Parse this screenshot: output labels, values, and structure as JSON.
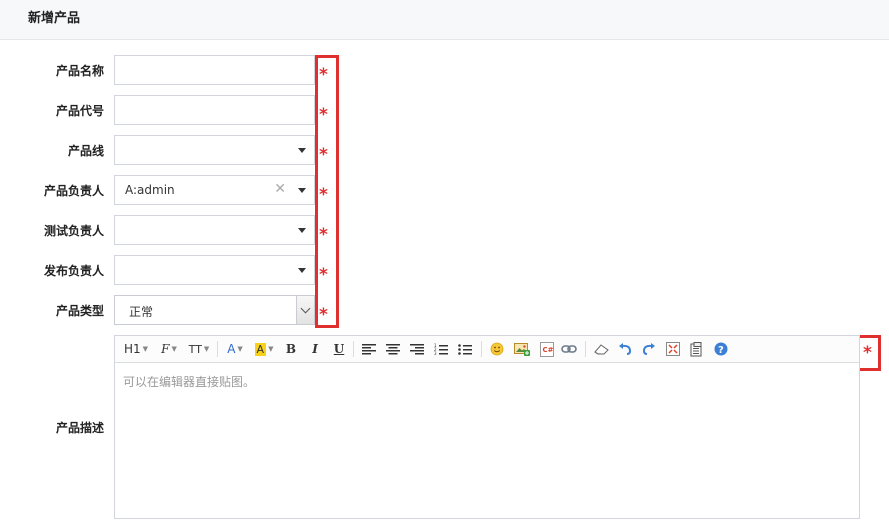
{
  "header": {
    "title": "新增产品"
  },
  "form": {
    "product_name": {
      "label": "产品名称",
      "value": ""
    },
    "product_code": {
      "label": "产品代号",
      "value": ""
    },
    "product_line": {
      "label": "产品线",
      "value": ""
    },
    "product_owner": {
      "label": "产品负责人",
      "value": "A:admin"
    },
    "test_owner": {
      "label": "测试负责人",
      "value": ""
    },
    "release_owner": {
      "label": "发布负责人",
      "value": ""
    },
    "product_type": {
      "label": "产品类型",
      "value": "正常"
    },
    "description": {
      "label": "产品描述",
      "placeholder": "可以在编辑器直接贴图。"
    }
  },
  "required_mark": "*",
  "toolbar": {
    "heading": "H1",
    "font_family": "F",
    "font_size": "TT",
    "font_color": "A",
    "bg_color": "A",
    "bold": "B",
    "italic": "I",
    "underline": "U"
  },
  "colors": {
    "required": "#e02f2f",
    "highlight": "#f8d21a"
  }
}
